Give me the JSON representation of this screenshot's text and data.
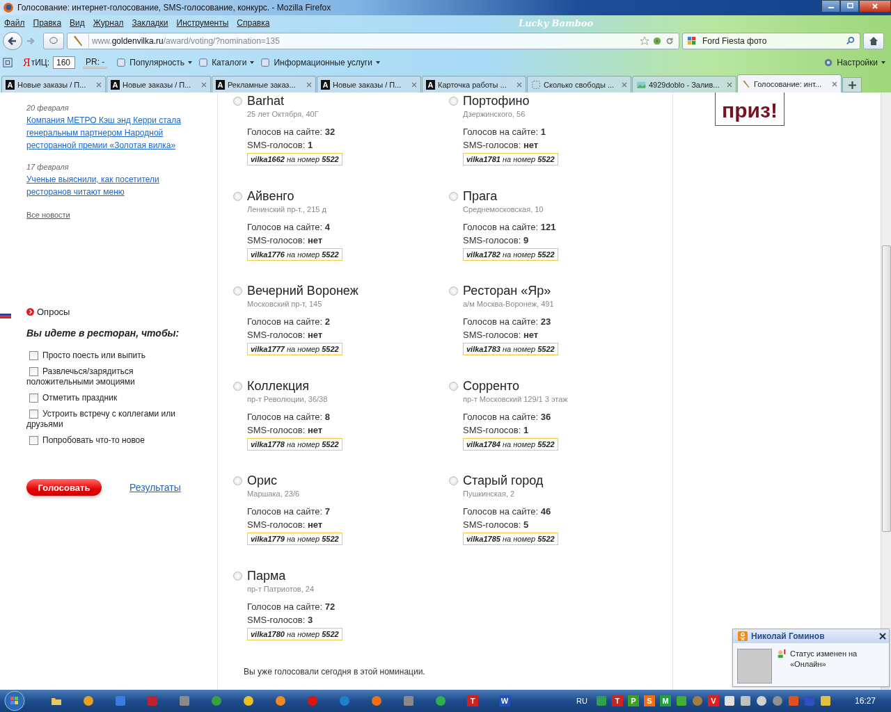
{
  "window": {
    "title": "Голосование: интернет-голосование, SMS-голосование, конкурс. - Mozilla Firefox",
    "theme": "Lucky Bamboo"
  },
  "menu": [
    "Файл",
    "Правка",
    "Вид",
    "Журнал",
    "Закладки",
    "Инструменты",
    "Справка"
  ],
  "nav": {
    "url_prefix": "www.",
    "url_host": "goldenvilka.ru",
    "url_path": "/award/voting/?nomination=135",
    "search_value": "Ford Fiesta  фото"
  },
  "toolbar": {
    "ya_letter": "Я",
    "tic_label": "тИЦ:",
    "tic_value": "160",
    "pr_label": "PR: -",
    "items": [
      "Популярность",
      "Каталоги",
      "Информационные услуги"
    ],
    "settings": "Настройки"
  },
  "tabs": [
    {
      "label": "Новые заказы / П...",
      "kind": "letter",
      "badge": "A",
      "selected": false
    },
    {
      "label": "Новые заказы / П...",
      "kind": "letter",
      "badge": "A",
      "selected": false
    },
    {
      "label": "Рекламные заказ...",
      "kind": "letter",
      "badge": "A",
      "selected": false
    },
    {
      "label": "Новые заказы / П...",
      "kind": "letter",
      "badge": "A",
      "selected": false
    },
    {
      "label": "Карточка работы ...",
      "kind": "letter",
      "badge": "A",
      "selected": false
    },
    {
      "label": "Сколько свободы ...",
      "kind": "blank",
      "selected": false
    },
    {
      "label": "4929doblo - Залив...",
      "kind": "image",
      "selected": false
    },
    {
      "label": "Голосование: инт...",
      "kind": "fork",
      "selected": true
    }
  ],
  "news": [
    {
      "date": "20 февраля",
      "title": "Компания МЕТРО Кэш энд Керри стала генеральным партнером Народной ресторанной премии «Золотая вилка»"
    },
    {
      "date": "17 февраля",
      "title": "Ученые выяснили, как посетители ресторанов читают меню"
    }
  ],
  "all_news": "Все новости",
  "poll": {
    "heading": "Опросы",
    "question": "Вы идете в ресторан, чтобы:",
    "options": [
      {
        "label": "Просто поесть или выпить",
        "checked": false
      },
      {
        "label": "Развлечься/зарядиться положительными эмоциями",
        "checked": false
      },
      {
        "label": "Отметить праздник",
        "checked": false
      },
      {
        "label": "Устроить встречу с коллегами или друзьями",
        "checked": false
      },
      {
        "label": "Попробовать что-то новое",
        "checked": false
      }
    ],
    "vote_button": "Голосовать",
    "results_link": "Результаты"
  },
  "restaurants": [
    {
      "name": "Barhat",
      "address": "25 лет Октября, 40Г",
      "site": "Голосов на сайте: **32**",
      "sms": "SMS-голосов: **1**",
      "code": "**vilka1662** на номер **5522**",
      "selected": false
    },
    {
      "name": "Портофино",
      "address": "Дзержинского, 56",
      "site": "Голосов на сайте: **1**",
      "sms": "SMS-голосов: **нет**",
      "code": "**vilka1781** на номер **5522**",
      "selected": false
    },
    {
      "name": "Айвенго",
      "address": "Ленинский пр-т., 215 д",
      "site": "Голосов на сайте: **4**",
      "sms": "SMS-голосов: **нет**",
      "code": "**vilka1776** на номер **5522**",
      "selected": false
    },
    {
      "name": "Прага",
      "address": "Среднемосковская, 10",
      "site": "Голосов на сайте: **121**",
      "sms": "SMS-голосов: **9**",
      "code": "**vilka1782** на номер **5522**",
      "selected": false
    },
    {
      "name": "Вечерний Воронеж",
      "address": "Московский пр-т, 145",
      "site": "Голосов на сайте: **2**",
      "sms": "SMS-голосов: **нет**",
      "code": "**vilka1777** на номер **5522**",
      "selected": false
    },
    {
      "name": "Ресторан «Яр»",
      "address": "а/м Москва-Воронеж, 491",
      "site": "Голосов на сайте: **23**",
      "sms": "SMS-голосов: **нет**",
      "code": "**vilka1783** на номер **5522**",
      "selected": false
    },
    {
      "name": "Коллекция",
      "address": "пр-т Революции, 36/38",
      "site": "Голосов на сайте: **8**",
      "sms": "SMS-голосов: **нет**",
      "code": "**vilka1778** на номер **5522**",
      "selected": false
    },
    {
      "name": "Сорренто",
      "address": "пр-т Московский 129/1 3 этаж",
      "site": "Голосов на сайте: **36**",
      "sms": "SMS-голосов: **1**",
      "code": "**vilka1784** на номер **5522**",
      "selected": false
    },
    {
      "name": "Орис",
      "address": "Маршака, 23/6",
      "site": "Голосов на сайте: **7**",
      "sms": "SMS-голосов: **нет**",
      "code": "**vilka1779** на номер **5522**",
      "selected": false
    },
    {
      "name": "Старый город",
      "address": "Пушкинская, 2",
      "site": "Голосов на сайте: **46**",
      "sms": "SMS-голосов: **5**",
      "code": "**vilka1785** на номер **5522**",
      "selected": false
    },
    {
      "name": "Парма",
      "address": "пр-т Патриотов, 24",
      "site": "Голосов на сайте: **72**",
      "sms": "SMS-голосов: **3**",
      "code": "**vilka1780** на номер **5522**",
      "selected": false
    }
  ],
  "voted_note": "Вы уже голосовали сегодня в этой номинации.",
  "prize_text": "приз!",
  "notification": {
    "name": "Николай Гоминов",
    "message": "Статус изменен на «Онлайн»"
  },
  "taskbar": {
    "apps": [
      {
        "kind": "folder"
      },
      {
        "kind": "round",
        "color": "#e8a020"
      },
      {
        "kind": "square",
        "color": "#3a7de0"
      },
      {
        "kind": "square",
        "color": "#c02030"
      },
      {
        "kind": "square",
        "color": "#8a8a8a"
      },
      {
        "kind": "round",
        "color": "#3aa040"
      },
      {
        "kind": "round",
        "color": "#e8c020"
      },
      {
        "kind": "round",
        "color": "#f08a20"
      },
      {
        "kind": "round",
        "color": "#e01010"
      },
      {
        "kind": "round",
        "color": "#2080d0"
      },
      {
        "kind": "round",
        "color": "#f07010"
      },
      {
        "kind": "square",
        "color": "#8a8a8a"
      },
      {
        "kind": "round",
        "color": "#30b050"
      },
      {
        "kind": "letter",
        "letter": "T",
        "color": "#d02020"
      },
      {
        "kind": "letter",
        "letter": "W",
        "color": "#2050c0"
      }
    ],
    "lang": "RU",
    "tray": [
      {
        "kind": "square",
        "color": "#30a050"
      },
      {
        "kind": "letter",
        "letter": "T",
        "color": "#d02020"
      },
      {
        "kind": "letter",
        "letter": "P",
        "color": "#40a020"
      },
      {
        "kind": "letter",
        "letter": "S",
        "color": "#f07010"
      },
      {
        "kind": "letter",
        "letter": "M",
        "color": "#20a040"
      },
      {
        "kind": "square",
        "color": "#40b030"
      },
      {
        "kind": "round",
        "color": "#a08040"
      },
      {
        "kind": "letter",
        "letter": "V",
        "color": "#e02020"
      },
      {
        "kind": "square",
        "color": "#e0e0e0"
      },
      {
        "kind": "square",
        "color": "#c0c0c0"
      },
      {
        "kind": "round",
        "color": "#d0d0d0"
      },
      {
        "kind": "round",
        "color": "#909090"
      },
      {
        "kind": "square",
        "color": "#e05020"
      },
      {
        "kind": "square",
        "color": "#3050c0"
      },
      {
        "kind": "square",
        "color": "#e0c040"
      }
    ],
    "clock": "16:27"
  }
}
